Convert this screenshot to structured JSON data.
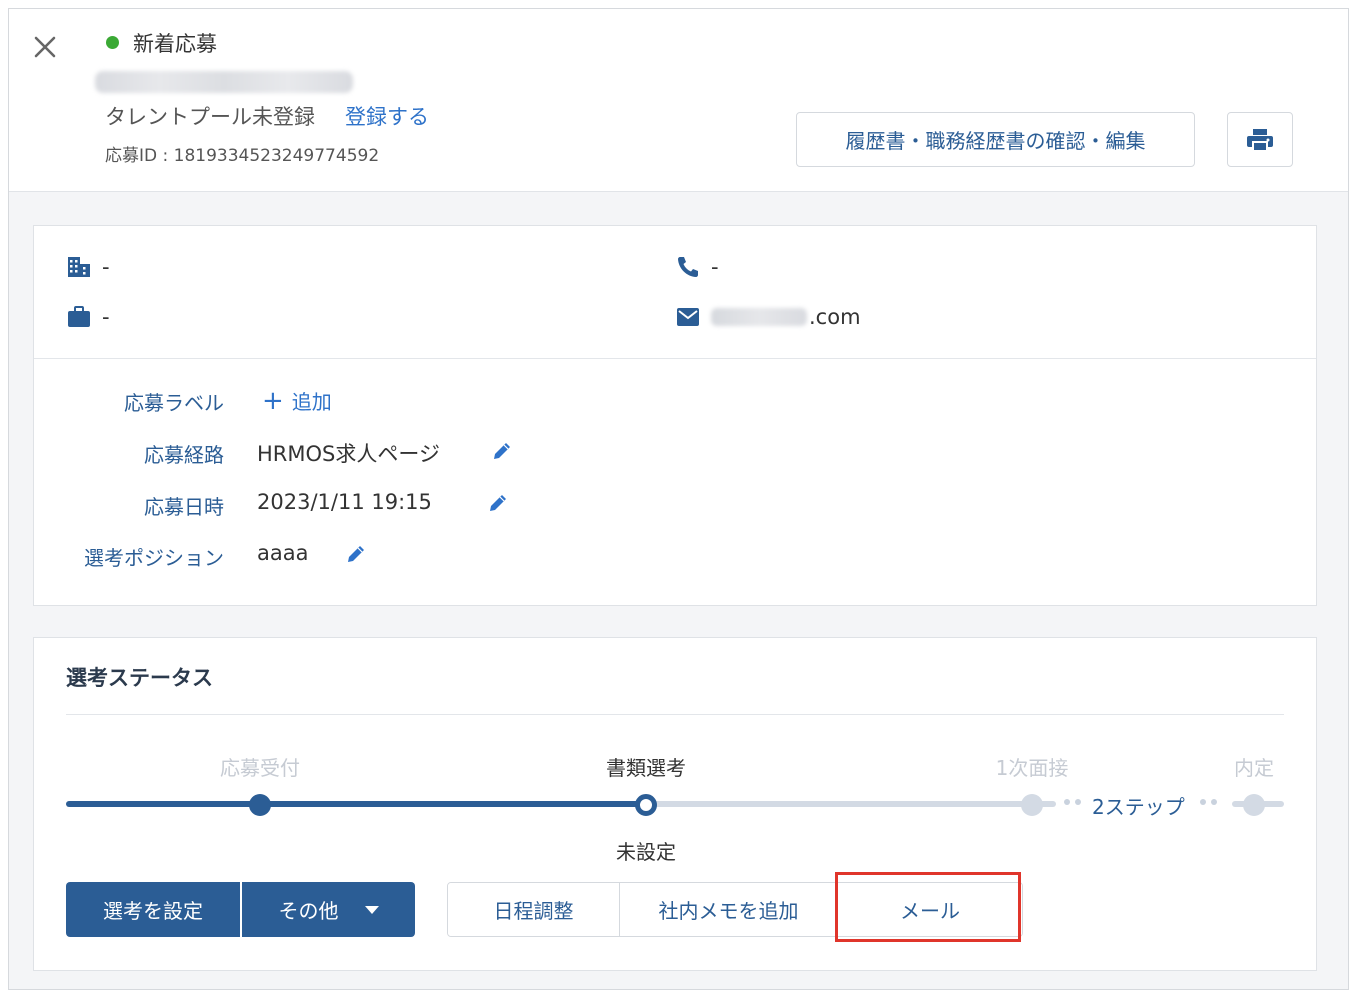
{
  "header": {
    "status": "新着応募",
    "talent_status": "タレントプール未登録",
    "register_link": "登録する",
    "application_id": "応募ID : 1819334523249774592",
    "resume_button": "履歴書・職務経歴書の確認・編集"
  },
  "contact": {
    "company": "-",
    "job": "-",
    "phone": "-",
    "email_suffix": ".com"
  },
  "fields": {
    "label": {
      "label": "応募ラベル",
      "add": "追加"
    },
    "route": {
      "label": "応募経路",
      "value": "HRMOS求人ページ"
    },
    "datetime": {
      "label": "応募日時",
      "value": "2023/1/11 19:15"
    },
    "position": {
      "label": "選考ポジション",
      "value": "aaaa"
    }
  },
  "selection": {
    "title": "選考ステータス",
    "steps": [
      "応募受付",
      "書類選考",
      "1次面接",
      "内定"
    ],
    "skipped": "2ステップ",
    "sub_status": "未設定",
    "buttons": {
      "set": "選考を設定",
      "other": "その他",
      "schedule": "日程調整",
      "memo": "社内メモを追加",
      "mail": "メール"
    }
  },
  "colors": {
    "primary": "#2b5d95",
    "link": "#2e72c9",
    "status_green": "#3ba935",
    "highlight": "#e0352b"
  }
}
